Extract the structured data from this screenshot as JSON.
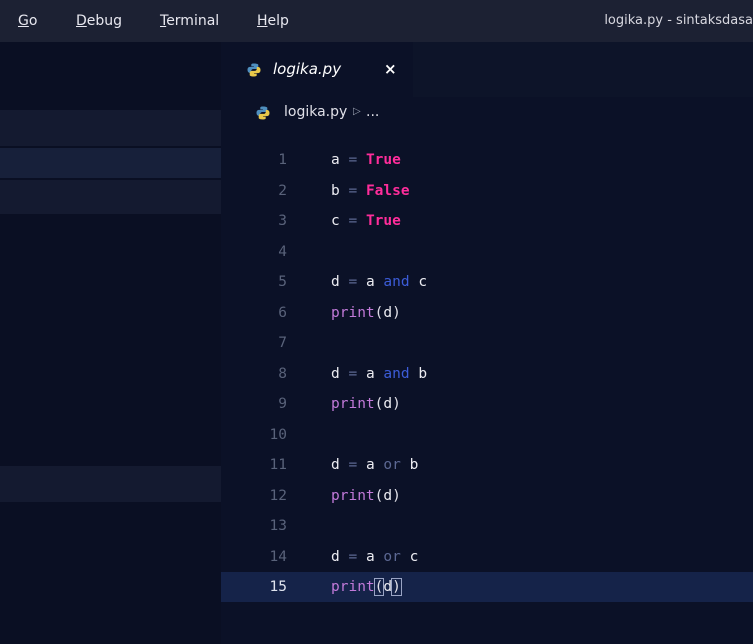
{
  "menu": {
    "items": [
      {
        "label": "Go",
        "mnemonic": "G",
        "rest": "o"
      },
      {
        "label": "Debug",
        "mnemonic": "D",
        "rest": "ebug"
      },
      {
        "label": "Terminal",
        "mnemonic": "T",
        "rest": "erminal"
      },
      {
        "label": "Help",
        "mnemonic": "H",
        "rest": "elp"
      }
    ],
    "window_title": "logika.py - sintaksdasa"
  },
  "tab": {
    "label": "logika.py",
    "close": "×",
    "icon": "python-icon"
  },
  "breadcrumb": {
    "file": "logika.py",
    "separator": "▷",
    "more": "..."
  },
  "code": {
    "lines": [
      {
        "n": "1",
        "tokens": [
          [
            "a",
            "var"
          ],
          [
            " ",
            ""
          ],
          [
            "=",
            "op"
          ],
          [
            " ",
            ""
          ],
          [
            "True",
            "kw"
          ]
        ]
      },
      {
        "n": "2",
        "tokens": [
          [
            "b",
            "var"
          ],
          [
            " ",
            ""
          ],
          [
            "=",
            "op"
          ],
          [
            " ",
            ""
          ],
          [
            "False",
            "kw"
          ]
        ]
      },
      {
        "n": "3",
        "tokens": [
          [
            "c",
            "var"
          ],
          [
            " ",
            ""
          ],
          [
            "=",
            "op"
          ],
          [
            " ",
            ""
          ],
          [
            "True",
            "kw"
          ]
        ]
      },
      {
        "n": "4",
        "tokens": []
      },
      {
        "n": "5",
        "tokens": [
          [
            "d",
            "var"
          ],
          [
            " ",
            ""
          ],
          [
            "=",
            "op"
          ],
          [
            " ",
            ""
          ],
          [
            "a",
            "var"
          ],
          [
            " ",
            ""
          ],
          [
            "and",
            "log"
          ],
          [
            " ",
            ""
          ],
          [
            "c",
            "var"
          ]
        ]
      },
      {
        "n": "6",
        "tokens": [
          [
            "print",
            "fn"
          ],
          [
            "(",
            "paren"
          ],
          [
            "d",
            "var"
          ],
          [
            ")",
            "paren"
          ]
        ]
      },
      {
        "n": "7",
        "tokens": []
      },
      {
        "n": "8",
        "tokens": [
          [
            "d",
            "var"
          ],
          [
            " ",
            ""
          ],
          [
            "=",
            "op"
          ],
          [
            " ",
            ""
          ],
          [
            "a",
            "var"
          ],
          [
            " ",
            ""
          ],
          [
            "and",
            "log"
          ],
          [
            " ",
            ""
          ],
          [
            "b",
            "var"
          ]
        ]
      },
      {
        "n": "9",
        "tokens": [
          [
            "print",
            "fn"
          ],
          [
            "(",
            "paren"
          ],
          [
            "d",
            "var"
          ],
          [
            ")",
            "paren"
          ]
        ]
      },
      {
        "n": "10",
        "tokens": []
      },
      {
        "n": "11",
        "tokens": [
          [
            "d",
            "var"
          ],
          [
            " ",
            ""
          ],
          [
            "=",
            "op"
          ],
          [
            " ",
            ""
          ],
          [
            "a",
            "var"
          ],
          [
            " ",
            ""
          ],
          [
            "or",
            "op"
          ],
          [
            " ",
            ""
          ],
          [
            "b",
            "var"
          ]
        ]
      },
      {
        "n": "12",
        "tokens": [
          [
            "print",
            "fn"
          ],
          [
            "(",
            "paren"
          ],
          [
            "d",
            "var"
          ],
          [
            ")",
            "paren"
          ]
        ]
      },
      {
        "n": "13",
        "tokens": []
      },
      {
        "n": "14",
        "tokens": [
          [
            "d",
            "var"
          ],
          [
            " ",
            ""
          ],
          [
            "=",
            "op"
          ],
          [
            " ",
            ""
          ],
          [
            "a",
            "var"
          ],
          [
            " ",
            ""
          ],
          [
            "or",
            "op"
          ],
          [
            " ",
            ""
          ],
          [
            "c",
            "var"
          ]
        ]
      },
      {
        "n": "15",
        "tokens": [
          [
            "print",
            "fn"
          ],
          [
            "(",
            "bm"
          ],
          [
            "d",
            "var"
          ],
          [
            ")",
            "bm"
          ]
        ],
        "current": true
      }
    ]
  },
  "colors": {
    "keyword": "#ff2d9b",
    "function": "#c27ad9",
    "logical": "#3c5cd8",
    "background": "#0b1127"
  }
}
